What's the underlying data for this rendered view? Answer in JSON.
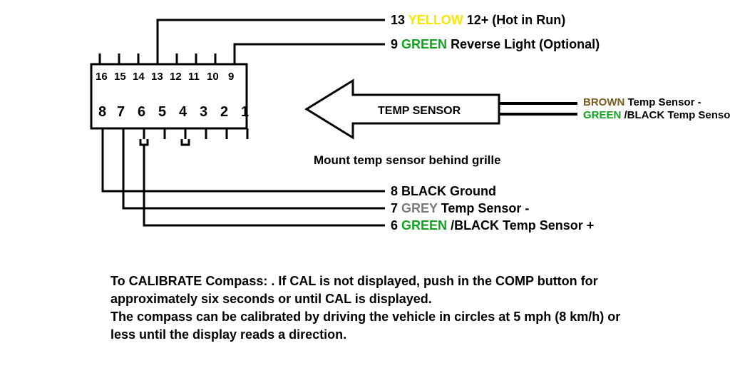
{
  "connector": {
    "top_pins": [
      "16",
      "15",
      "14",
      "13",
      "12",
      "11",
      "10",
      "9"
    ],
    "bottom_pins": [
      "8",
      "7",
      "6",
      "5",
      "4",
      "3",
      "2",
      "1"
    ]
  },
  "wires": {
    "pin13": {
      "num": "13",
      "color": "YELLOW",
      "desc": " 12+ (Hot in Run)",
      "color_hex": "#f6e700"
    },
    "pin9": {
      "num": "9",
      "color": "GREEN",
      "desc": " Reverse Light (Optional)",
      "color_hex": "#11a320"
    },
    "pin8": {
      "num": "8",
      "color": "BLACK",
      "desc": " Ground",
      "color_hex": "#000"
    },
    "pin7": {
      "num": "7",
      "color": "GREY",
      "desc": " Temp Sensor -",
      "color_hex": "#7a7a7a"
    },
    "pin6": {
      "num": "6",
      "color": "GREEN",
      "desc": "/BLACK Temp Sensor +",
      "color_hex": "#11a320"
    }
  },
  "temp_sensor": {
    "arrow_label": "TEMP SENSOR",
    "mount_note": "Mount temp sensor behind grille",
    "brown": {
      "color": "BROWN",
      "desc": " Temp Sensor -",
      "color_hex": "#7a5b1f"
    },
    "greenblack": {
      "color": "GREEN",
      "desc": "/BLACK Temp Sensor +",
      "color_hex": "#11a320"
    }
  },
  "calibration": {
    "line1": "To CALIBRATE Compass: . If CAL is not displayed, push in the COMP button for",
    "line2": "approximately six seconds or until CAL is displayed.",
    "line3": "The compass can be calibrated by driving the vehicle in circles at 5 mph (8 km/h) or",
    "line4": "less until the display reads a direction."
  }
}
